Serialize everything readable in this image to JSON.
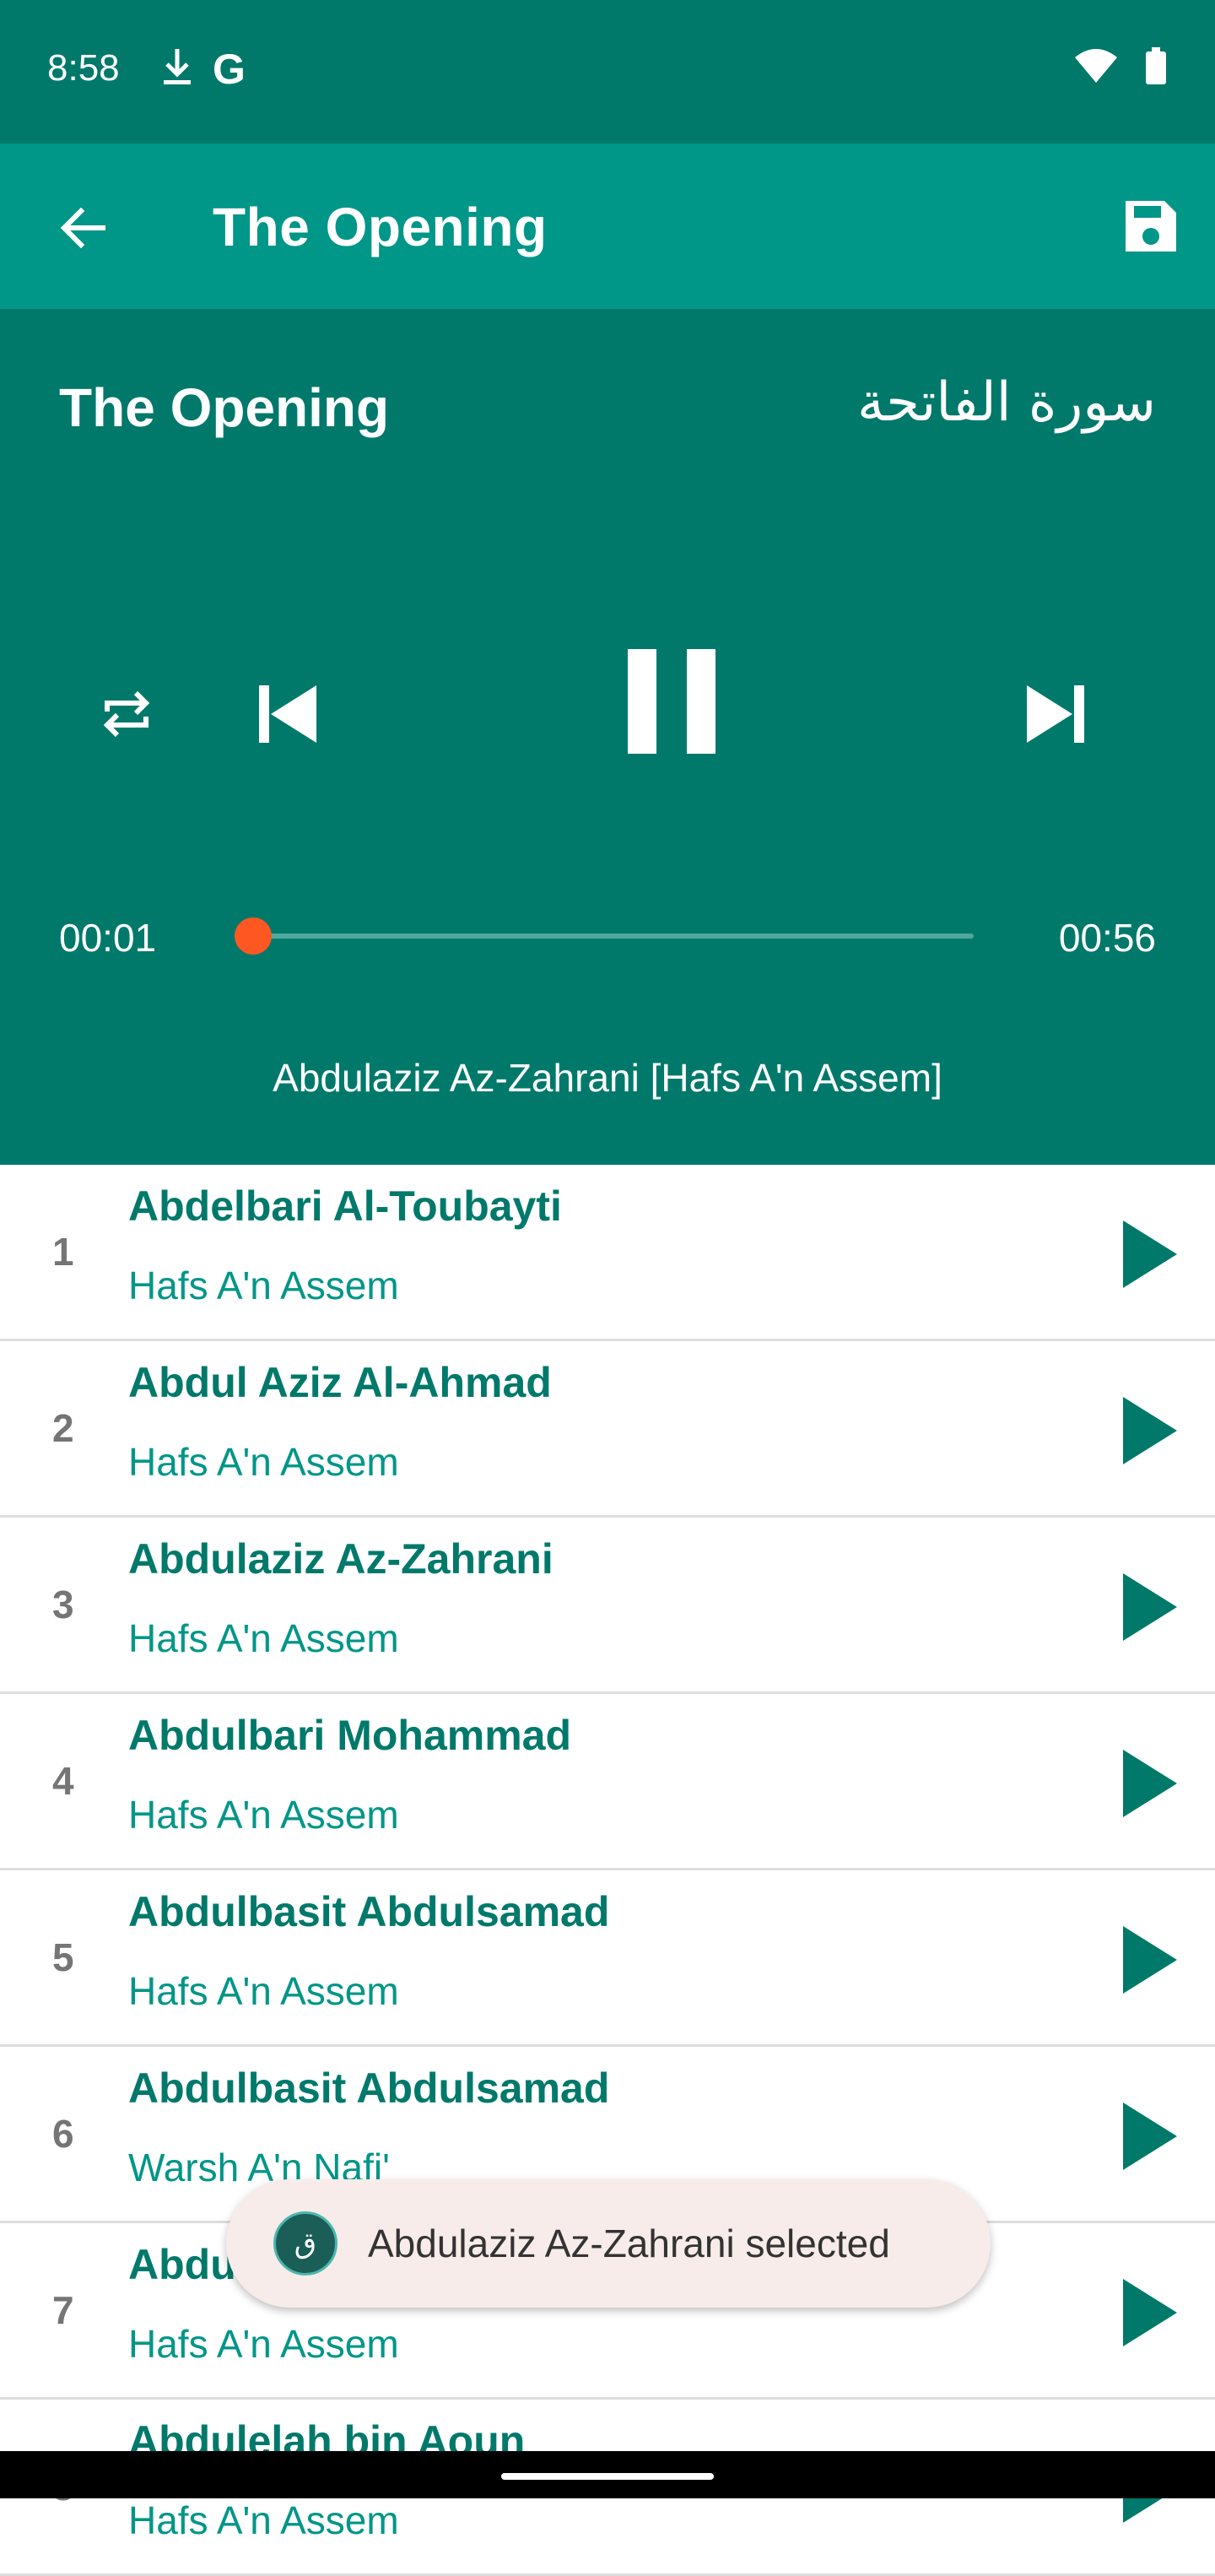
{
  "status_bar": {
    "time": "8:58",
    "left_icons": [
      "download-icon",
      "google-icon"
    ],
    "right_icons": [
      "wifi-icon",
      "battery-icon"
    ]
  },
  "app_bar": {
    "title": "The Opening"
  },
  "player": {
    "surah_en": "The Opening",
    "surah_ar": "سورة الفاتحة",
    "time_current": "00:01",
    "time_total": "00:56",
    "progress_percent": 1.8,
    "now_playing": "Abdulaziz Az-Zahrani [Hafs A'n Assem]"
  },
  "reciters": [
    {
      "num": "1",
      "name": "Abdelbari Al-Toubayti",
      "riwaya": "Hafs A'n Assem"
    },
    {
      "num": "2",
      "name": "Abdul Aziz Al-Ahmad",
      "riwaya": "Hafs A'n Assem"
    },
    {
      "num": "3",
      "name": "Abdulaziz Az-Zahrani",
      "riwaya": "Hafs A'n Assem"
    },
    {
      "num": "4",
      "name": "Abdulbari Mohammad",
      "riwaya": "Hafs A'n Assem"
    },
    {
      "num": "5",
      "name": "Abdulbasit Abdulsamad",
      "riwaya": "Hafs A'n Assem"
    },
    {
      "num": "6",
      "name": "Abdulbasit Abdulsamad",
      "riwaya": "Warsh A'n Nafi'"
    },
    {
      "num": "7",
      "name": "Abdullah Basfar",
      "riwaya": "Hafs A'n Assem"
    },
    {
      "num": "8",
      "name": "Abdulelah bin Aoun",
      "riwaya": "Hafs A'n Assem"
    }
  ],
  "toast": {
    "text": "Abdulaziz Az-Zahrani selected"
  },
  "colors": {
    "primary_dark": "#00796b",
    "primary": "#009688",
    "accent": "#ff5722"
  }
}
